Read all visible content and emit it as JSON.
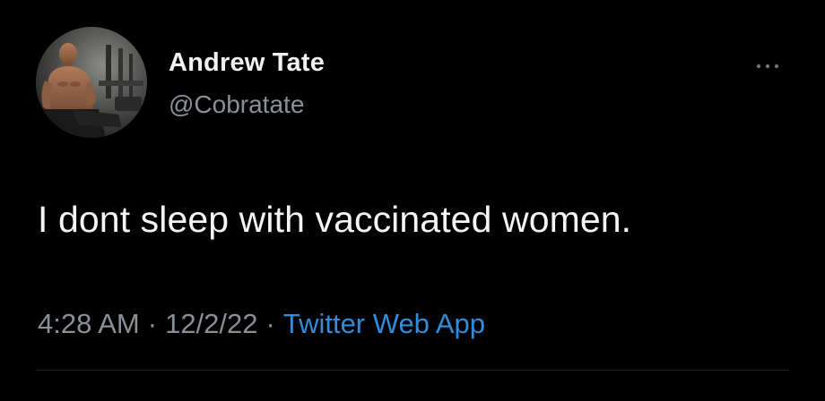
{
  "author": {
    "display_name": "Andrew Tate",
    "handle": "@Cobratate"
  },
  "tweet": {
    "text": "I dont sleep with vaccinated women.",
    "time": "4:28 AM",
    "date": "12/2/22",
    "source": "Twitter Web App",
    "separator": "·"
  },
  "icons": {
    "more": "more-horizontal-icon",
    "avatar": "profile-photo"
  },
  "colors": {
    "background": "#000000",
    "name": "#f1f1f1",
    "secondary": "#8b9096",
    "link": "#2f8ddc"
  }
}
